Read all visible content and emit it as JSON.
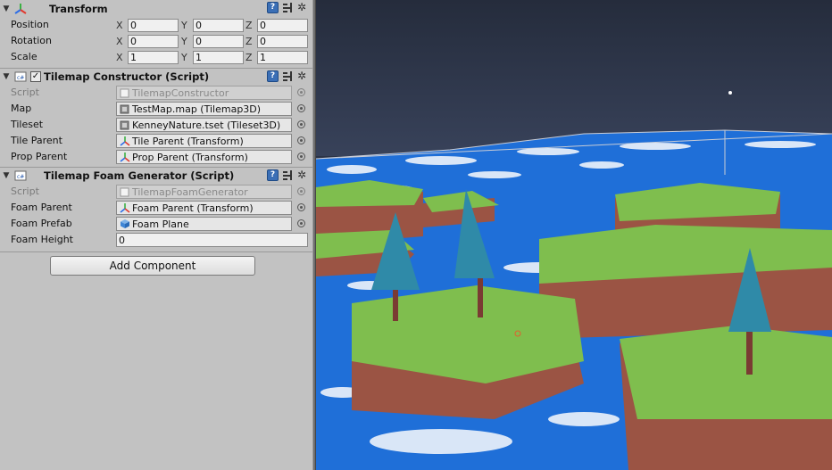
{
  "transform": {
    "title": "Transform",
    "rows": [
      {
        "label": "Position",
        "x": "0",
        "y": "0",
        "z": "0"
      },
      {
        "label": "Rotation",
        "x": "0",
        "y": "0",
        "z": "0"
      },
      {
        "label": "Scale",
        "x": "1",
        "y": "1",
        "z": "1"
      }
    ],
    "axes": {
      "x": "X",
      "y": "Y",
      "z": "Z"
    }
  },
  "tilemap_constructor": {
    "title": "Tilemap Constructor (Script)",
    "enabled_mark": "✓",
    "fields": [
      {
        "label": "Script",
        "value": "TilemapConstructor",
        "icon": "script-icon"
      },
      {
        "label": "Map",
        "value": "TestMap.map (Tilemap3D)",
        "icon": "asset-icon"
      },
      {
        "label": "Tileset",
        "value": "KenneyNature.tset (Tileset3D)",
        "icon": "asset-icon"
      },
      {
        "label": "Tile Parent",
        "value": "Tile Parent (Transform)",
        "icon": "transform-icon"
      },
      {
        "label": "Prop Parent",
        "value": "Prop Parent (Transform)",
        "icon": "transform-icon"
      }
    ]
  },
  "foam_generator": {
    "title": "Tilemap Foam Generator (Script)",
    "fields": [
      {
        "label": "Script",
        "value": "TilemapFoamGenerator",
        "icon": "script-icon"
      },
      {
        "label": "Foam Parent",
        "value": "Foam Parent (Transform)",
        "icon": "transform-icon"
      },
      {
        "label": "Foam Prefab",
        "value": "Foam Plane",
        "icon": "prefab-icon"
      },
      {
        "label": "Foam Height",
        "value": "0"
      }
    ]
  },
  "add_component": {
    "label": "Add Component"
  },
  "header_icons": {
    "help": "?",
    "gear": "✲"
  },
  "colors": {
    "panel": "#c2c2c2",
    "sky": "#2c3446",
    "water": "#1f6fd8",
    "foam": "#eef3fb",
    "grass": "#7fbe4e",
    "cliff": "#9b5444",
    "tree": "#2f8aa8",
    "trunk": "#7a3b33"
  }
}
